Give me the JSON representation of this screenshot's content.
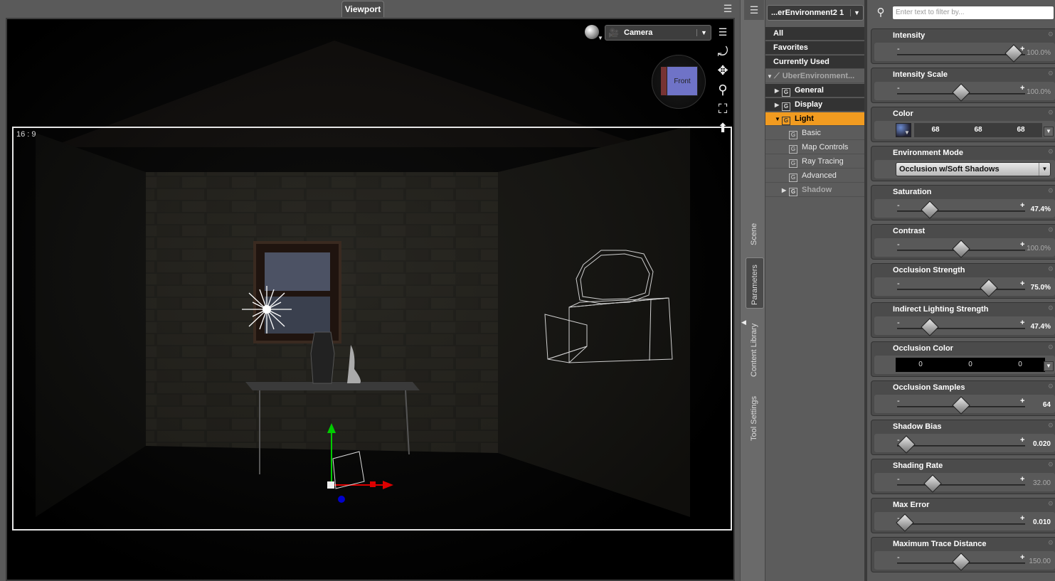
{
  "viewport": {
    "tab_label": "Viewport",
    "aspect_label": "16 : 9",
    "camera_label": "Camera",
    "cube_label": "Front"
  },
  "sidetabs": {
    "scene": "Scene",
    "parameters": "Parameters",
    "content_library": "Content Library",
    "tool_settings": "Tool Settings"
  },
  "tree": {
    "node_label": "...erEnvironment2 1",
    "items": [
      {
        "label": "All"
      },
      {
        "label": "Favorites"
      },
      {
        "label": "Currently Used"
      },
      {
        "label": "UberEnvironment..."
      },
      {
        "label": "General"
      },
      {
        "label": "Display"
      },
      {
        "label": "Light"
      },
      {
        "label": "Basic"
      },
      {
        "label": "Map Controls"
      },
      {
        "label": "Ray Tracing"
      },
      {
        "label": "Advanced"
      },
      {
        "label": "Shadow"
      }
    ]
  },
  "filter": {
    "placeholder": "Enter text to filter by..."
  },
  "params": [
    {
      "title": "Intensity",
      "value": "100.0%",
      "fraction": 0.92
    },
    {
      "title": "Intensity Scale",
      "value": "100.0%",
      "fraction": 0.5
    },
    {
      "title": "Color",
      "r": "68",
      "g": "68",
      "b": "68"
    },
    {
      "title": "Environment Mode",
      "mode": "Occlusion w/Soft Shadows"
    },
    {
      "title": "Saturation",
      "value": "47.4%",
      "fraction": 0.25
    },
    {
      "title": "Contrast",
      "value": "100.0%",
      "fraction": 0.5
    },
    {
      "title": "Occlusion Strength",
      "value": "75.0%",
      "fraction": 0.72
    },
    {
      "title": "Indirect Lighting Strength",
      "value": "47.4%",
      "fraction": 0.25
    },
    {
      "title": "Occlusion Color",
      "r": "0",
      "g": "0",
      "b": "0"
    },
    {
      "title": "Occlusion Samples",
      "value": "64",
      "fraction": 0.5
    },
    {
      "title": "Shadow Bias",
      "value": "0.020",
      "fraction": 0.06
    },
    {
      "title": "Shading Rate",
      "value": "32.00",
      "fraction": 0.27
    },
    {
      "title": "Max Error",
      "value": "0.010",
      "fraction": 0.05
    },
    {
      "title": "Maximum Trace Distance",
      "value": "150.00",
      "fraction": 0.5
    }
  ]
}
